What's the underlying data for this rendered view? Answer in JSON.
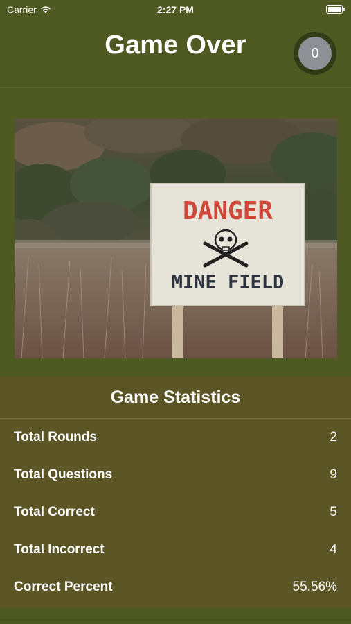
{
  "status_bar": {
    "carrier": "Carrier",
    "time": "2:27 PM",
    "icons": [
      "wifi-icon",
      "battery-icon"
    ]
  },
  "header": {
    "title": "Game Over",
    "score": "0"
  },
  "image": {
    "sign_text_top": "DANGER",
    "sign_text_bottom": "MINE FIELD",
    "icon": "skull-crossbones-icon"
  },
  "stats": {
    "title": "Game Statistics",
    "rows": [
      {
        "label": "Total Rounds",
        "value": "2"
      },
      {
        "label": "Total Questions",
        "value": "9"
      },
      {
        "label": "Total Correct",
        "value": "5"
      },
      {
        "label": "Total Incorrect",
        "value": "4"
      },
      {
        "label": "Correct Percent",
        "value": "55.56%"
      }
    ]
  },
  "colors": {
    "background": "#4e5a22",
    "stats_background": "#5c5627",
    "score_badge": "#8e9095",
    "sign_red": "#d0473a"
  }
}
